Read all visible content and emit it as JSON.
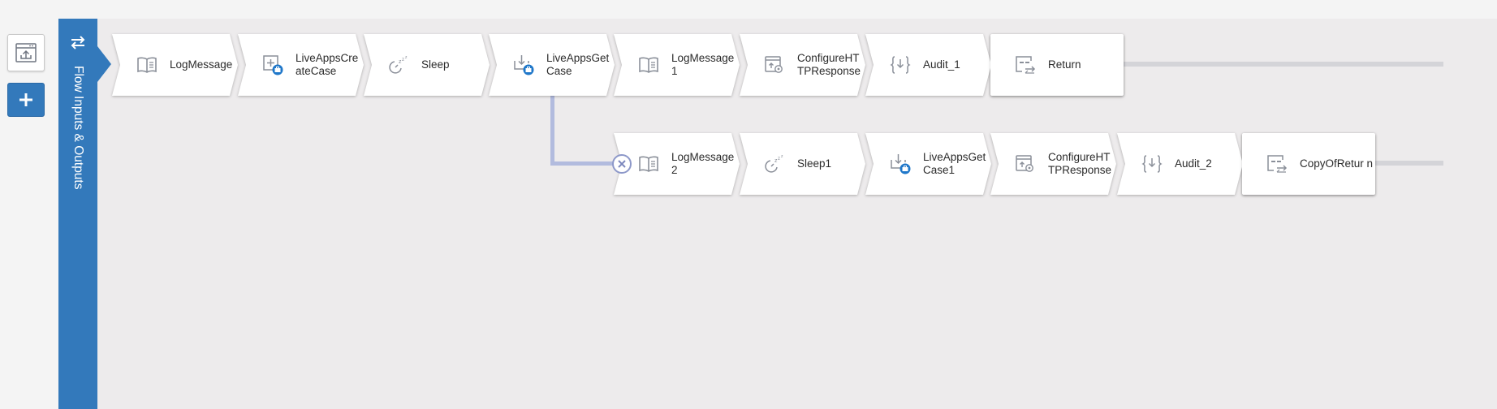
{
  "toolbar": {
    "export_icon": "export-flow-icon",
    "add_label": "+"
  },
  "flow_panel": {
    "toggle_icon": "swap-arrows-icon",
    "label": "Flow Inputs & Outputs"
  },
  "colors": {
    "accent": "#3379bb",
    "canvas": "#edebec",
    "branch_line": "#b2bbde",
    "icon_gray": "#8a8f99",
    "icon_blue": "#1f77c9"
  },
  "main_flow": [
    {
      "label": "LogMessage",
      "icon": "book-icon"
    },
    {
      "label": "LiveAppsCreateCase",
      "display": "LiveAppsCre ateCase",
      "icon": "liveapps-create-icon"
    },
    {
      "label": "Sleep",
      "icon": "sleep-icon"
    },
    {
      "label": "LiveAppsGet Case",
      "icon": "liveapps-get-icon"
    },
    {
      "label": "LogMessage 1",
      "icon": "book-icon"
    },
    {
      "label": "ConfigureHT TPResponse",
      "icon": "configure-response-icon"
    },
    {
      "label": "Audit_1",
      "icon": "braces-icon"
    },
    {
      "label": "Return",
      "icon": "return-icon"
    }
  ],
  "error_flow": [
    {
      "label": "LogMessage 2",
      "icon": "book-icon"
    },
    {
      "label": "Sleep1",
      "icon": "sleep-icon"
    },
    {
      "label": "LiveAppsGet Case1",
      "icon": "liveapps-get-icon"
    },
    {
      "label": "ConfigureHT TPResponse",
      "icon": "configure-response-icon"
    },
    {
      "label": "Audit_2",
      "icon": "braces-icon"
    },
    {
      "label": "CopyOfRetur n",
      "icon": "return-icon"
    }
  ],
  "error_branch_icon": "error-branch-icon"
}
